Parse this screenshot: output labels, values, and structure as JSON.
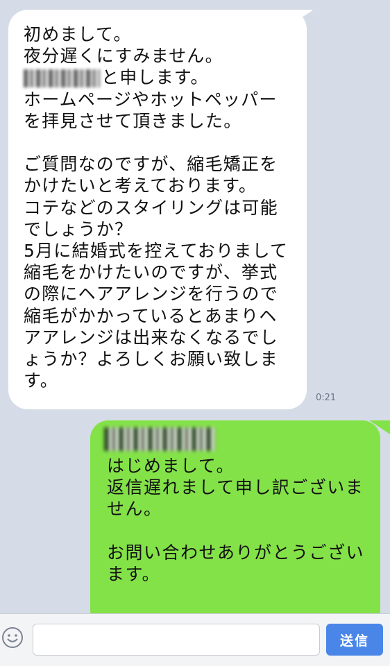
{
  "received": {
    "lines": [
      "初めまして。",
      "夜分遅くにすみません。",
      "と申します。",
      "ホームページやホットペッパー",
      "を拝見させて頂きました。",
      "",
      "ご質問なのですが、縮毛矯正を",
      "かけたいと考えております。",
      "コテなどのスタイリングは可能",
      "でしょうか？",
      "5月に結婚式を控えておりまして",
      "縮毛をかけたいのですが、挙式",
      "の際にヘアアレンジを行うので",
      "縮毛がかかっているとあまりヘ",
      "アアレンジは出来なくなるでし",
      "ょうか？よろしくお願い致しま",
      "す。"
    ],
    "time": "0:21"
  },
  "sent": {
    "lines": [
      "はじめまして。",
      "返信遅れまして申し訳ございま",
      "せん。",
      "",
      "お問い合わせありがとうござい",
      "ます。"
    ]
  },
  "input": {
    "placeholder": "",
    "send_label": "送信"
  },
  "colors": {
    "background": "#d5dce7",
    "received_bubble": "#ffffff",
    "sent_bubble": "#84e249",
    "send_button": "#4a86e8"
  },
  "icons": {
    "emoji": "smiley-icon"
  }
}
